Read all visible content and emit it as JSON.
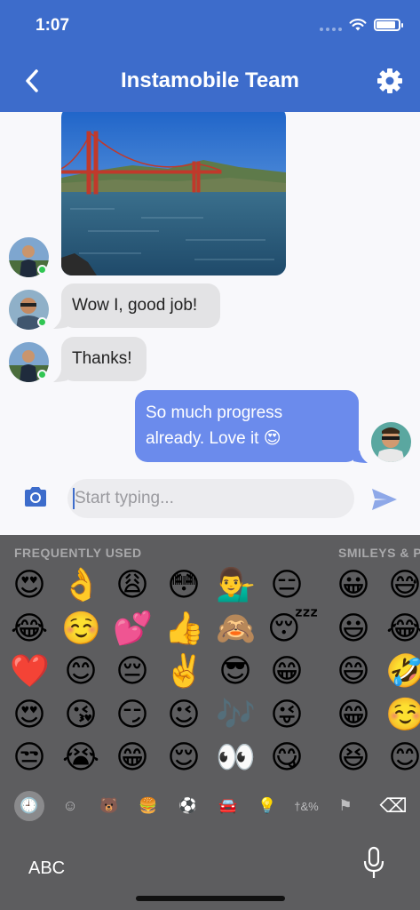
{
  "status": {
    "time": "1:07"
  },
  "header": {
    "title": "Instamobile Team"
  },
  "messages": [
    {
      "text": "Wow I, good job!"
    },
    {
      "text": "Thanks!"
    },
    {
      "line1": "So much progress",
      "line2": "already. Love it 😍"
    }
  ],
  "composer": {
    "placeholder": "Start typing..."
  },
  "keyboard": {
    "section_frequent": "FREQUENTLY USED",
    "section_smileys": "SMILEYS & P",
    "emoji": [
      [
        "😍",
        "👌",
        "😩",
        "😳",
        "💁‍♂️",
        "😑",
        "😀",
        "😅"
      ],
      [
        "😂",
        "☺️",
        "💕",
        "👍",
        "🙈",
        "😴",
        "😃",
        "😂"
      ],
      [
        "❤️",
        "😊",
        "😔",
        "✌️",
        "😎",
        "😁",
        "😄",
        "🤣"
      ],
      [
        "😍",
        "😘",
        "😏",
        "😉",
        "🎶",
        "😜",
        "😁",
        "☺️"
      ],
      [
        "😒",
        "😭",
        "😁",
        "😌",
        "👀",
        "😋",
        "😆",
        "😊"
      ]
    ],
    "categories": [
      "🕘",
      "☺",
      "🐻",
      "🍔",
      "⚽",
      "🚘",
      "💡",
      "†&%",
      "⚑",
      "⌫"
    ],
    "abc_label": "ABC"
  },
  "colors": {
    "header": "#3d6ccb",
    "outgoing_bubble": "#6b8bec",
    "incoming_bubble": "#e3e3e5",
    "keyboard": "#5d5d5f",
    "online": "#31c653"
  }
}
